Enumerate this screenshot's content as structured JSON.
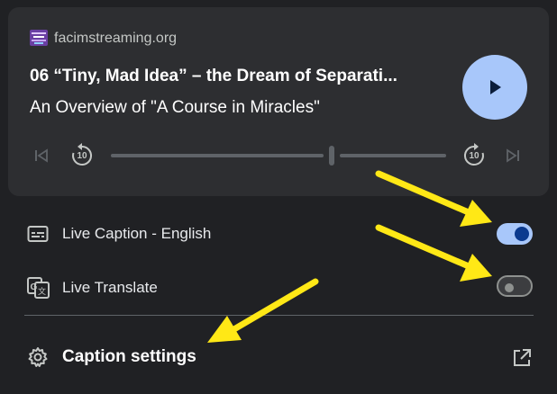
{
  "media": {
    "site": "facimstreaming.org",
    "title": "06 “Tiny, Mad Idea” – the Dream of Separati...",
    "subtitle": "An Overview of \"A Course in Miracles\"",
    "seek_back_seconds": "10",
    "seek_forward_seconds": "10",
    "progress": 0.65,
    "state": "paused"
  },
  "live_caption": {
    "label": "Live Caption - English",
    "enabled": true
  },
  "live_translate": {
    "label": "Live Translate",
    "enabled": false
  },
  "caption_settings": {
    "label": "Caption settings"
  },
  "annotations": {
    "arrow_color": "#ffe816",
    "count": 3
  },
  "colors": {
    "accent": "#a8c7fa",
    "toggle_knob_on": "#0b3a8f"
  }
}
